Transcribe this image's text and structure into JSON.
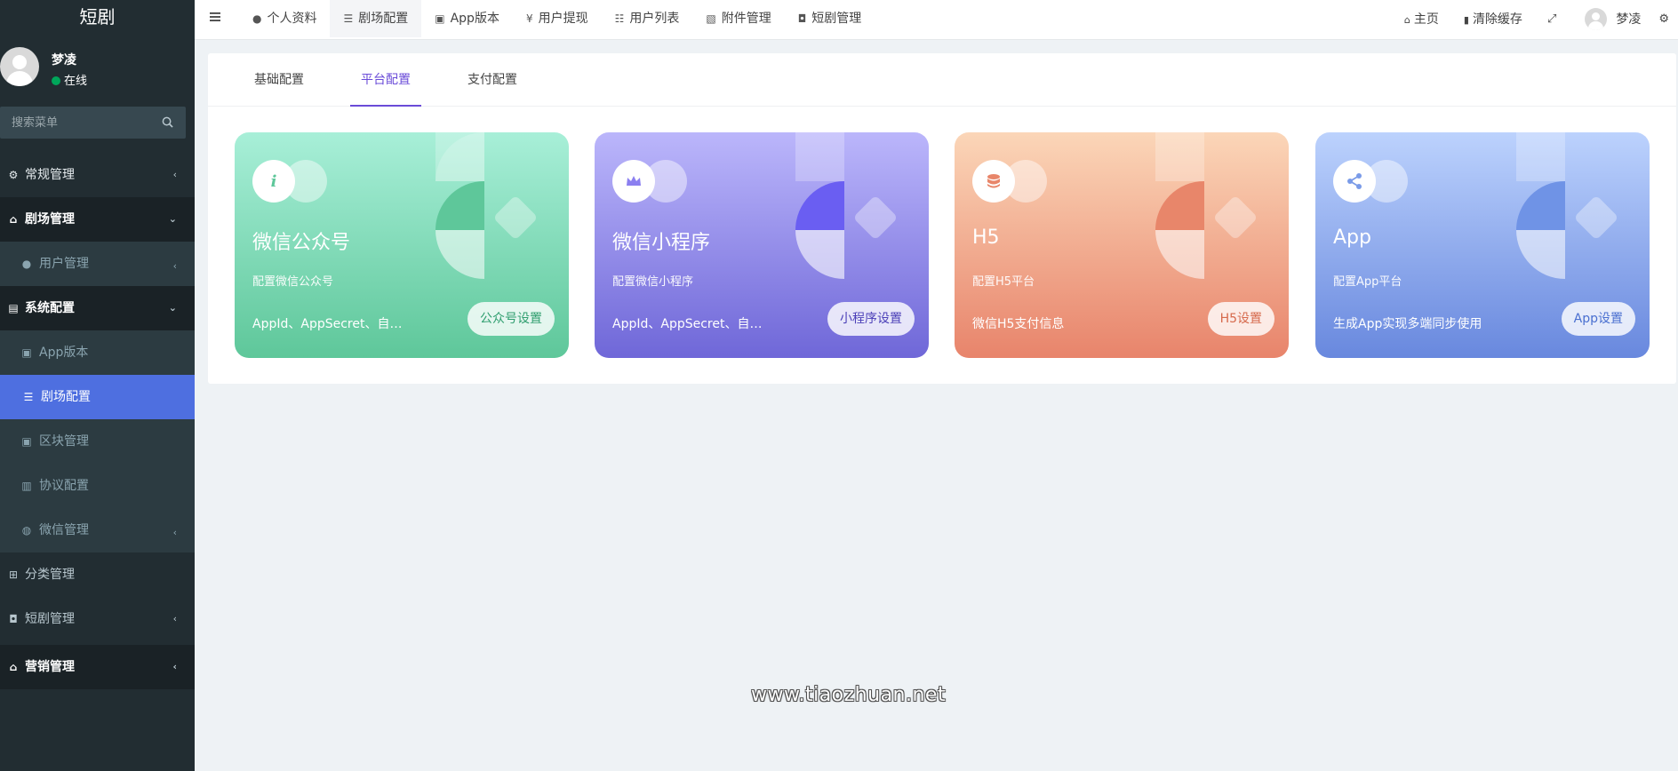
{
  "app": {
    "brand": "短剧",
    "watermark": "www.tiaozhuan.net"
  },
  "sidebar": {
    "user": {
      "name": "梦凌",
      "status": "在线"
    },
    "search": {
      "placeholder": "搜索菜单",
      "icon": "search-icon"
    },
    "menu": [
      {
        "label": "常规管理",
        "icon": "cogs-icon"
      },
      {
        "label": "剧场管理",
        "icon": "home-icon",
        "expanded": true,
        "children": [
          {
            "label": "用户管理",
            "icon": "user-icon"
          }
        ]
      },
      {
        "label": "系统配置",
        "icon": "file-icon",
        "expanded": true,
        "children": [
          {
            "label": "App版本",
            "icon": "image-icon"
          },
          {
            "label": "剧场配置",
            "icon": "sliders-icon",
            "active": true
          },
          {
            "label": "区块管理",
            "icon": "image-icon"
          },
          {
            "label": "协议配置",
            "icon": "book-icon"
          },
          {
            "label": "微信管理",
            "icon": "wechat-icon"
          }
        ]
      },
      {
        "label": "分类管理",
        "icon": "sitemap-icon"
      },
      {
        "label": "短剧管理",
        "icon": "shopping-bag-icon"
      },
      {
        "label": "营销管理",
        "icon": "home-icon"
      }
    ]
  },
  "navbar": {
    "tabs": [
      {
        "label": "个人资料",
        "icon": "user-icon"
      },
      {
        "label": "剧场配置",
        "icon": "sliders-icon",
        "active": true
      },
      {
        "label": "App版本",
        "icon": "image-icon"
      },
      {
        "label": "用户提现",
        "icon": "yen-icon"
      },
      {
        "label": "用户列表",
        "icon": "list-icon"
      },
      {
        "label": "附件管理",
        "icon": "file-image-icon"
      },
      {
        "label": "短剧管理",
        "icon": "shopping-bag-icon"
      }
    ],
    "right": {
      "home": "主页",
      "clear_cache": "清除缓存",
      "user": "梦凌"
    }
  },
  "panel": {
    "tabs": [
      {
        "label": "基础配置"
      },
      {
        "label": "平台配置",
        "active": true
      },
      {
        "label": "支付配置"
      }
    ],
    "cards": [
      {
        "title": "微信公众号",
        "desc": "配置微信公众号",
        "info": "AppId、AppSecret、自定义菜单等",
        "button": "公众号设置",
        "icon": "info-icon",
        "theme": "green",
        "accent": "#2f9e6e"
      },
      {
        "title": "微信小程序",
        "desc": "配置微信小程序",
        "info": "AppId、AppSecret、自定义等",
        "button": "小程序设置",
        "icon": "crown-icon",
        "theme": "purple",
        "accent": "#4b3fb8"
      },
      {
        "title": "H5",
        "desc": "配置H5平台",
        "info": "微信H5支付信息",
        "button": "H5设置",
        "icon": "database-icon",
        "theme": "orange",
        "accent": "#d66a4c"
      },
      {
        "title": "App",
        "desc": "配置App平台",
        "info": "生成App实现多端同步使用",
        "button": "App设置",
        "icon": "share-icon",
        "theme": "blue",
        "accent": "#4a6fd0"
      }
    ]
  }
}
